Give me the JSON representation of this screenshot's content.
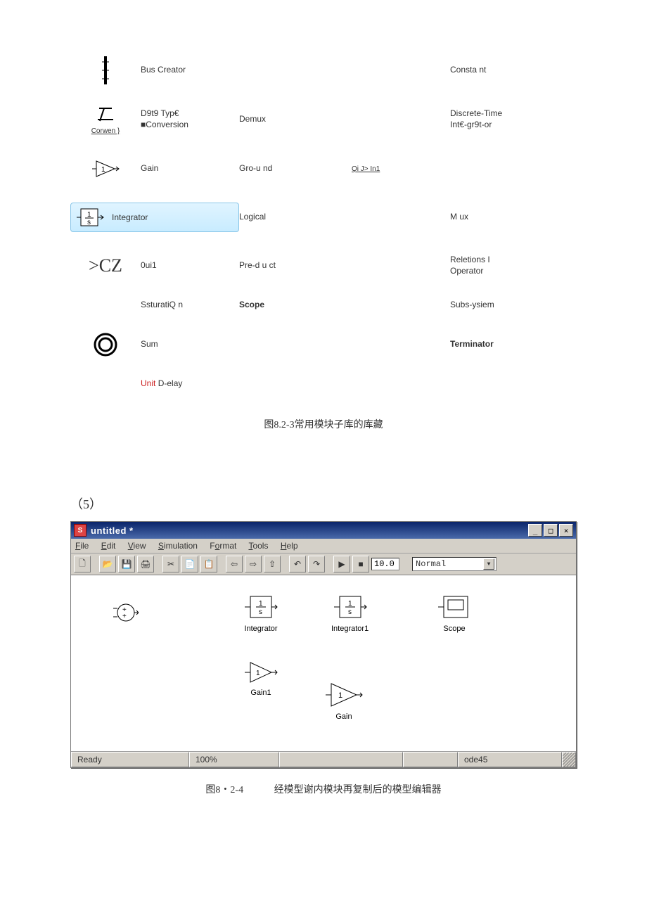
{
  "library": {
    "rows": [
      {
        "c1_label": "Bus Creator",
        "c3_label": "Consta nt"
      },
      {
        "c0_sub": "Corwen }",
        "c1_label": "D9t9 Typ€\n■Conversion",
        "c2_label": "Demux",
        "c3_label": "Discrete-Time\nInt€-gr9t-or"
      },
      {
        "c1_label": "Gain",
        "c2_label": "Gro-u nd",
        "c2b_label": "Qi J> In1"
      },
      {
        "c1_label": "Integrator",
        "c2_label": "Logical",
        "c3_label": "M ux"
      },
      {
        "c0_text": ">CZ",
        "c1_label": "0ui1",
        "c2_label": "Pre-d u ct",
        "c3_label": "Reletions I\nOperator"
      },
      {
        "c1_label": "SsturatiQ n",
        "c2_label": "Scope",
        "c2_bold": true,
        "c3_label": "Subs-ysiem"
      },
      {
        "c1_label": "Sum",
        "c3_label": "Terminator",
        "c3_bold": true
      },
      {
        "c1_label": "Unit D-elay",
        "c1_prefix_red": "Unit "
      }
    ]
  },
  "caption1": "图8.2-3常用模块子库的库藏",
  "section_label": "（5）",
  "window": {
    "title": "untitled *",
    "menus": [
      "File",
      "Edit",
      "View",
      "Simulation",
      "Format",
      "Tools",
      "Help"
    ],
    "menu_underlines": [
      "F",
      "E",
      "V",
      "S",
      "o",
      "T",
      "H"
    ],
    "stop_time": "10.0",
    "mode": "Normal",
    "blocks": {
      "integrator": "Integrator",
      "integrator1": "Integrator1",
      "scope": "Scope",
      "gain1": "Gain1",
      "gain": "Gain"
    },
    "status": {
      "ready": "Ready",
      "zoom": "100%",
      "solver": "ode45"
    }
  },
  "caption2_label": "图8・2-4",
  "caption2_text": "经模型谢内模块再复制后的模型编辑器"
}
